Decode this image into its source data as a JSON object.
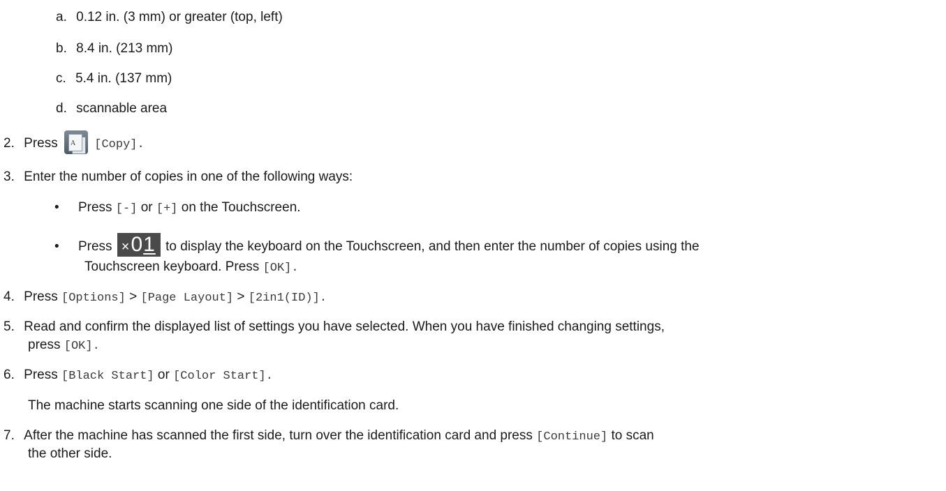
{
  "sublist": [
    {
      "marker": "a.",
      "text": "0.12 in. (3 mm) or greater (top, left)"
    },
    {
      "marker": "b.",
      "text": "8.4 in. (213 mm)"
    },
    {
      "marker": "c.",
      "text": "5.4 in. (137 mm)"
    },
    {
      "marker": "d.",
      "text": "scannable area"
    }
  ],
  "step2": {
    "num": "2.",
    "press": "Press",
    "copy_icon_letter": "A",
    "copy_label": "[Copy]",
    "end": "."
  },
  "step3": {
    "num": "3.",
    "text": "Enter the number of copies in one of the following ways:",
    "bullet1": {
      "press": "Press",
      "minus": "[-]",
      "or": "or",
      "plus": "[+]",
      "rest": "on the Touchscreen."
    },
    "bullet2": {
      "press": "Press",
      "count_x": "×",
      "count_digit0": "0",
      "count_digit1": "1",
      "rest": "to display the keyboard on the Touchscreen, and then enter the number of copies using the",
      "line2": "Touchscreen keyboard. Press",
      "ok": "[OK]",
      "end": "."
    }
  },
  "step4": {
    "num": "4.",
    "press": "Press",
    "options": "[Options]",
    "sep1": ">",
    "page_layout": "[Page Layout]",
    "sep2": ">",
    "twoin1": "[2in1(ID)]",
    "end": "."
  },
  "step5": {
    "num": "5.",
    "text": "Read and confirm the displayed list of settings you have selected. When you have finished changing settings,",
    "line2": "press",
    "ok": "[OK]",
    "end": "."
  },
  "step6": {
    "num": "6.",
    "press": "Press",
    "black": "[Black Start]",
    "or": "or",
    "color": "[Color Start]",
    "end": ".",
    "note": "The machine starts scanning one side of the identification card."
  },
  "step7": {
    "num": "7.",
    "text": "After the machine has scanned the first side, turn over the identification card and press",
    "continue": "[Continue]",
    "rest": "to scan",
    "line2": "the other side."
  },
  "colors": {
    "text": "#1a1a1a",
    "mono": "#3a3a3a",
    "count_bg": "#4a4a4a"
  }
}
